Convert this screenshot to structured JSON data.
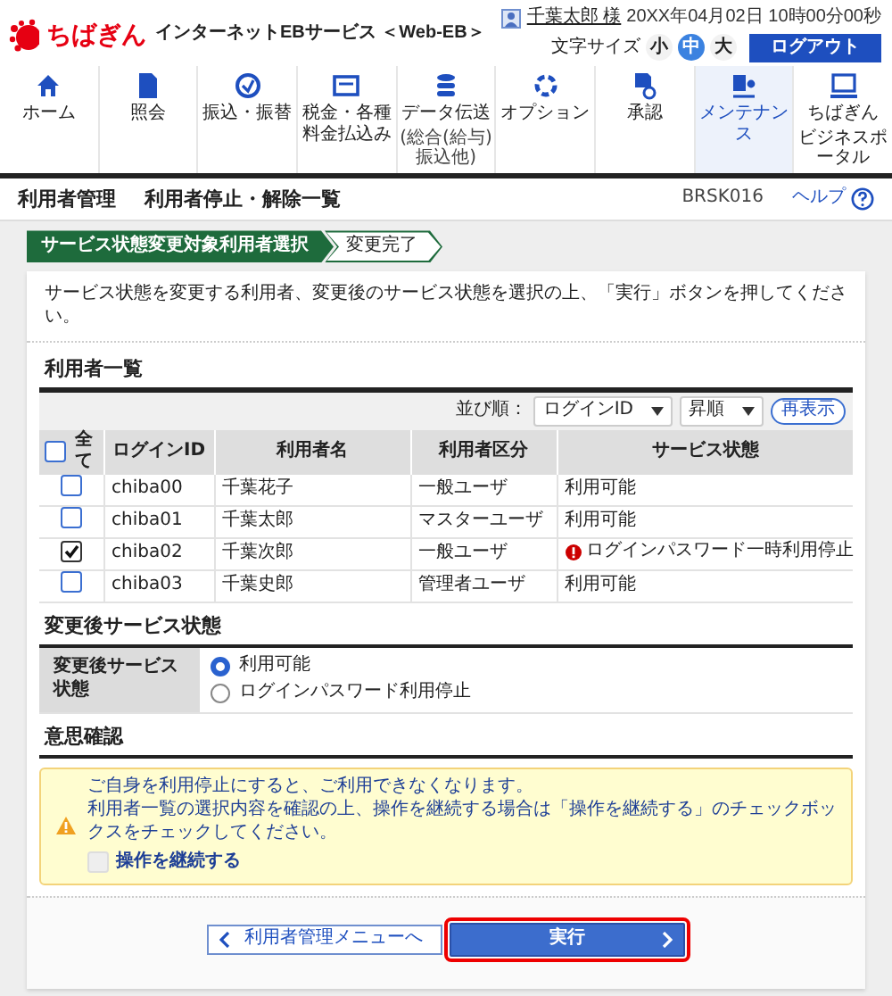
{
  "header": {
    "brand": "ちばぎん",
    "service": "インターネットEBサービス ＜Web-EB＞",
    "user_name": "千葉太郎 様",
    "datetime": "20XX年04月02日 10時00分00秒",
    "font_size_label": "文字サイズ",
    "font_sizes": [
      {
        "label": "小",
        "selected": false
      },
      {
        "label": "中",
        "selected": true
      },
      {
        "label": "大",
        "selected": false
      }
    ],
    "logout": "ログアウト"
  },
  "nav": [
    {
      "label": "ホーム",
      "selected": false
    },
    {
      "label": "照会",
      "selected": false
    },
    {
      "label": "振込・振替",
      "selected": false
    },
    {
      "label": "税金・各種料金払込み",
      "selected": false
    },
    {
      "label": "データ伝送",
      "sublabel": "(総合(給与)振込他)",
      "selected": false
    },
    {
      "label": "オプション",
      "selected": false
    },
    {
      "label": "承認",
      "selected": false
    },
    {
      "label": "メンテナンス",
      "selected": true
    },
    {
      "label": "ちばぎん",
      "sublabel": "ビジネスポータル",
      "selected": false
    }
  ],
  "page": {
    "category": "利用者管理",
    "title": "利用者停止・解除一覧",
    "screen_id": "BRSK016",
    "help": "ヘルプ"
  },
  "steps": [
    {
      "label": "サービス状態変更対象利用者選択",
      "selected": true
    },
    {
      "label": "変更完了",
      "selected": false
    }
  ],
  "instruction": "サービス状態を変更する利用者、変更後のサービス状態を選択の上、「実行」ボタンを押してください。",
  "user_list": {
    "heading": "利用者一覧",
    "sort_label": "並び順：",
    "sort_field": "ログインID",
    "sort_order": "昇順",
    "refresh": "再表示",
    "select_all": {
      "label": "全て",
      "checked": false
    },
    "columns": [
      "ログインID",
      "利用者名",
      "利用者区分",
      "サービス状態"
    ],
    "rows": [
      {
        "checked": false,
        "login_id": "chiba00",
        "name": "千葉花子",
        "type": "一般ユーザ",
        "status": "利用可能",
        "alert": false
      },
      {
        "checked": false,
        "login_id": "chiba01",
        "name": "千葉太郎",
        "type": "マスターユーザ",
        "status": "利用可能",
        "alert": false
      },
      {
        "checked": true,
        "login_id": "chiba02",
        "name": "千葉次郎",
        "type": "一般ユーザ",
        "status": "ログインパスワード一時利用停止",
        "alert": true
      },
      {
        "checked": false,
        "login_id": "chiba03",
        "name": "千葉史郎",
        "type": "管理者ユーザ",
        "status": "利用可能",
        "alert": false
      }
    ]
  },
  "new_status": {
    "heading": "変更後サービス状態",
    "label": "変更後サービス状態",
    "options": [
      {
        "label": "利用可能",
        "selected": true
      },
      {
        "label": "ログインパスワード利用停止",
        "selected": false
      }
    ]
  },
  "confirm": {
    "heading": "意思確認",
    "messages": [
      "ご自身を利用停止にすると、ご利用できなくなります。",
      "利用者一覧の選択内容を確認の上、操作を継続する場合は「操作を継続する」のチェックボックスをチェックしてください。"
    ],
    "checkbox": {
      "label": "操作を継続する",
      "checked": false
    }
  },
  "actions": {
    "back": "利用者管理メニューへ",
    "execute": "実行",
    "execute_highlighted": true
  }
}
